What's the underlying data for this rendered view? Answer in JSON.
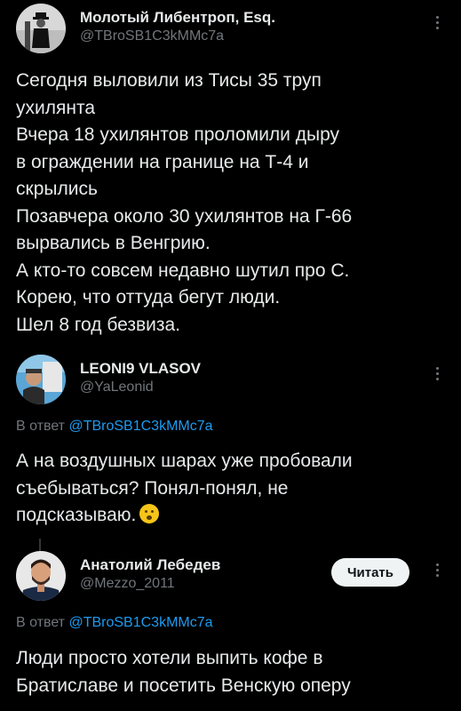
{
  "tweets": [
    {
      "name": "Молотый Либентроп, Esq.",
      "handle": "@TBroSB1C3kMMc7a",
      "lines": [
        "Сегодня выловили из Тисы 35 труп",
        "ухилянта",
        "Вчера 18 ухилянтов проломили дыру",
        "в ограждении на границе на Т-4 и",
        "скрылись",
        "Позавчера около 30 ухилянтов на Г-66",
        "вырвались в Венгрию.",
        "А кто-то совсем недавно шутил про С.",
        "Корею, что оттуда бегут люди.",
        "Шел 8 год безвиза."
      ]
    },
    {
      "name": "LEONI9 VLASOV",
      "handle": "@YaLeonid",
      "reply_prefix": "В ответ",
      "reply_handle": "@TBroSB1C3kMMc7a",
      "lines": [
        "А на воздушных шарах уже пробовали",
        "съебываться? Понял-понял, не",
        "подсказываю."
      ]
    },
    {
      "name": "Анатолий Лебедев",
      "handle": "@Mezzo_2011",
      "reply_prefix": "В ответ",
      "reply_handle": "@TBroSB1C3kMMc7a",
      "follow_label": "Читать",
      "lines": [
        "Люди просто хотели выпить кофе в",
        "Братиславе и посетить Венскую оперу"
      ]
    }
  ],
  "colors": {
    "background": "#000000",
    "text": "#e7e9ea",
    "muted": "#71767b",
    "link": "#1d9bf0",
    "button_bg": "#eff3f4"
  },
  "icons": {
    "more": "more-vertical-icon",
    "emoji": "hushed-face-emoji-icon"
  }
}
